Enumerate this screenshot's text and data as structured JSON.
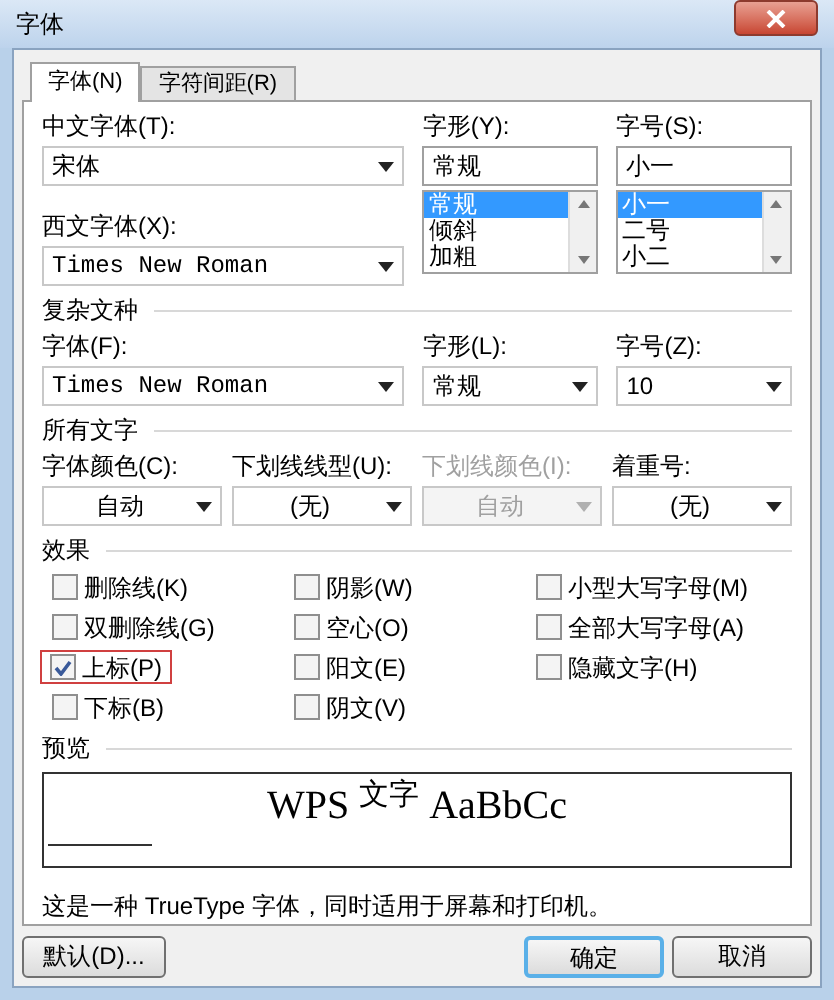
{
  "window": {
    "title": "字体"
  },
  "tabs": [
    {
      "label": "字体(N)",
      "selected": true
    },
    {
      "label": "字符间距(R)",
      "selected": false
    }
  ],
  "chinese_font": {
    "label": "中文字体(T):",
    "value": "宋体"
  },
  "western_font": {
    "label": "西文字体(X):",
    "value": "Times New Roman"
  },
  "style": {
    "label": "字形(Y):",
    "value": "常规",
    "options": [
      {
        "label": "常规",
        "selected": true
      },
      {
        "label": "倾斜",
        "selected": false
      },
      {
        "label": "加粗",
        "selected": false
      }
    ]
  },
  "size": {
    "label": "字号(S):",
    "value": "小一",
    "options": [
      {
        "label": "小一",
        "selected": true
      },
      {
        "label": "二号",
        "selected": false
      },
      {
        "label": "小二",
        "selected": false
      }
    ]
  },
  "complex_script": {
    "title": "复杂文种",
    "font": {
      "label": "字体(F):",
      "value": "Times New Roman"
    },
    "style": {
      "label": "字形(L):",
      "value": "常规"
    },
    "size": {
      "label": "字号(Z):",
      "value": "10"
    }
  },
  "all_text": {
    "title": "所有文字",
    "fields": [
      {
        "label": "字体颜色(C):",
        "value": "自动",
        "disabled": false
      },
      {
        "label": "下划线线型(U):",
        "value": "(无)",
        "disabled": false
      },
      {
        "label": "下划线颜色(I):",
        "value": "自动",
        "disabled": true
      },
      {
        "label": "着重号:",
        "value": "(无)",
        "disabled": false
      }
    ]
  },
  "effects": {
    "title": "效果",
    "columns": [
      [
        {
          "label": "删除线(K)",
          "checked": false,
          "highlighted": false
        },
        {
          "label": "双删除线(G)",
          "checked": false,
          "highlighted": false
        },
        {
          "label": "上标(P)",
          "checked": true,
          "highlighted": true
        },
        {
          "label": "下标(B)",
          "checked": false,
          "highlighted": false
        }
      ],
      [
        {
          "label": "阴影(W)",
          "checked": false,
          "highlighted": false
        },
        {
          "label": "空心(O)",
          "checked": false,
          "highlighted": false
        },
        {
          "label": "阳文(E)",
          "checked": false,
          "highlighted": false
        },
        {
          "label": "阴文(V)",
          "checked": false,
          "highlighted": false
        }
      ],
      [
        {
          "label": "小型大写字母(M)",
          "checked": false,
          "highlighted": false
        },
        {
          "label": "全部大写字母(A)",
          "checked": false,
          "highlighted": false
        },
        {
          "label": "隐藏文字(H)",
          "checked": false,
          "highlighted": false
        }
      ]
    ]
  },
  "preview": {
    "title": "预览",
    "text": "WPS $^{文字}$ AaBbCc"
  },
  "description": "这是一种 TrueType 字体，同时适用于屏幕和打印机。",
  "buttons": [
    {
      "label": "默认(D)...",
      "default": false
    },
    {
      "label": "确定",
      "default": true
    },
    {
      "label": "取消",
      "default": false
    }
  ]
}
